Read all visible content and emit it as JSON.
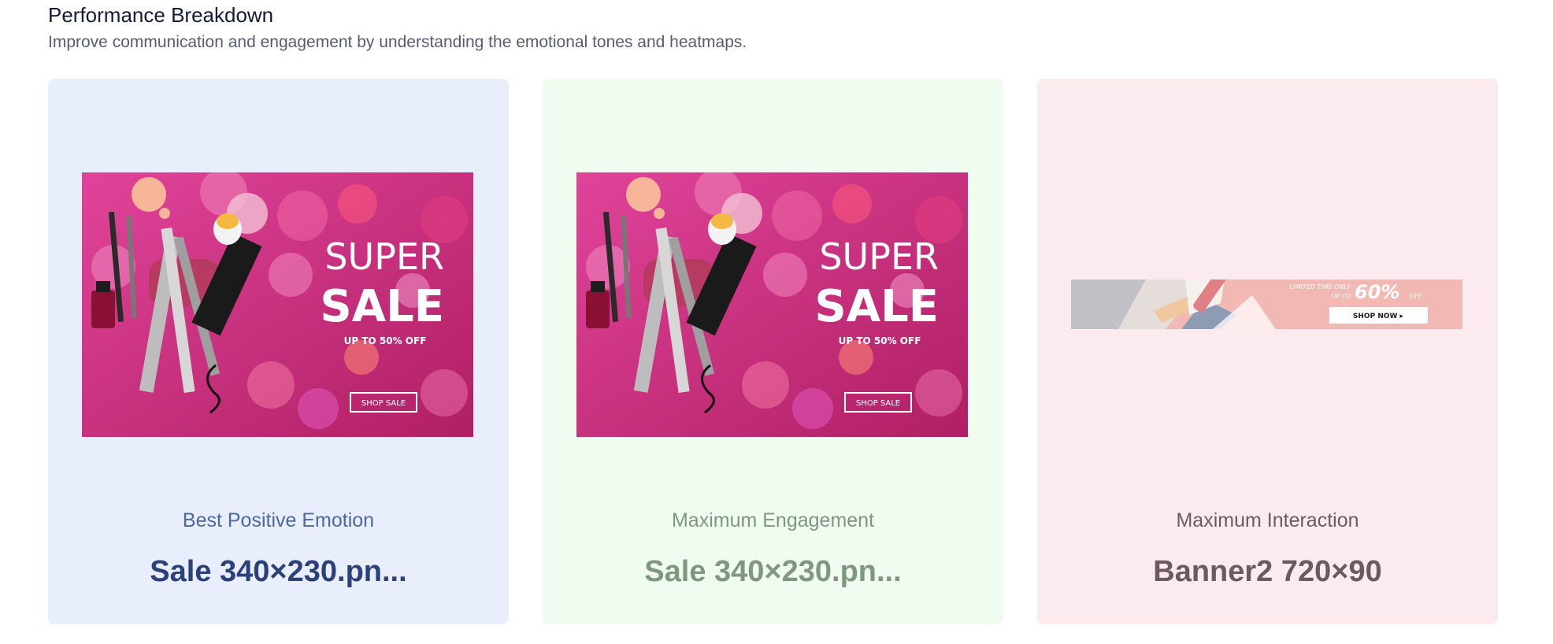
{
  "header": {
    "title": "Performance Breakdown",
    "subtitle": "Improve communication and engagement by understanding the emotional tones and heatmaps."
  },
  "cards": [
    {
      "label": "Best Positive Emotion",
      "filename": "Sale 340×230.pn...",
      "image": {
        "line1": "SUPER",
        "line2": "SALE",
        "offer": "UP TO 50% OFF",
        "button": "SHOP SALE"
      }
    },
    {
      "label": "Maximum Engagement",
      "filename": "Sale 340×230.pn...",
      "image": {
        "line1": "SUPER",
        "line2": "SALE",
        "offer": "UP TO 50% OFF",
        "button": "SHOP SALE"
      }
    },
    {
      "label": "Maximum Interaction",
      "filename": "Banner2 720×90",
      "image": {
        "limited": "LIMITED TIME ONLY",
        "upto": "UP TO",
        "percent": "60%",
        "off": "OFF",
        "button": "SHOP NOW ▸"
      }
    }
  ],
  "colors": {
    "card_blue_bg": "#e9eefc",
    "card_green_bg": "#f1fcf1",
    "card_pink_bg": "#fcebee",
    "sale_magenta": "#c8276f"
  }
}
